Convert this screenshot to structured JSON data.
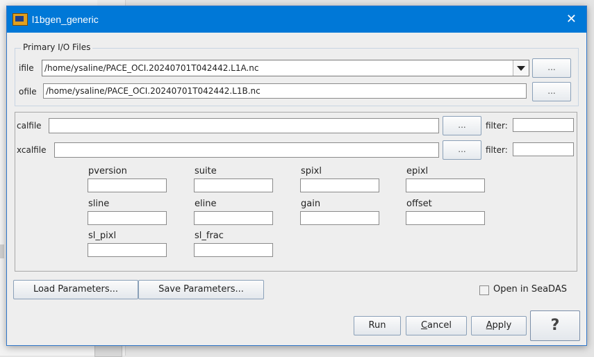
{
  "window": {
    "title": "l1bgen_generic",
    "close_icon": "close-icon"
  },
  "io": {
    "legend": "Primary I/O Files",
    "ifile_label": "ifile",
    "ifile_value": "/home/ysaline/PACE_OCI.20240701T042442.L1A.nc",
    "ofile_label": "ofile",
    "ofile_value": "/home/ysaline/PACE_OCI.20240701T042442.L1B.nc",
    "browse_label": "..."
  },
  "cal": {
    "calfile_label": "calfile",
    "calfile_value": "",
    "xcalfile_label": "xcalfile",
    "xcalfile_value": "",
    "browse_label": "...",
    "filter_label": "filter:"
  },
  "params": [
    {
      "label": "pversion",
      "value": ""
    },
    {
      "label": "suite",
      "value": ""
    },
    {
      "label": "spixl",
      "value": ""
    },
    {
      "label": "epixl",
      "value": ""
    },
    {
      "label": "sline",
      "value": ""
    },
    {
      "label": "eline",
      "value": ""
    },
    {
      "label": "gain",
      "value": ""
    },
    {
      "label": "offset",
      "value": ""
    },
    {
      "label": "sl_pixl",
      "value": ""
    },
    {
      "label": "sl_frac",
      "value": ""
    }
  ],
  "buttons": {
    "load": "Load Parameters...",
    "save": "Save Parameters...",
    "open_in_seadas": "Open in SeaDAS",
    "run": "Run",
    "cancel_first": "C",
    "cancel_rest": "ancel",
    "apply_first": "A",
    "apply_rest": "pply",
    "help": "?"
  },
  "colors": {
    "titlebar": "#0078d7",
    "dialog_bg": "#eeeeee"
  }
}
